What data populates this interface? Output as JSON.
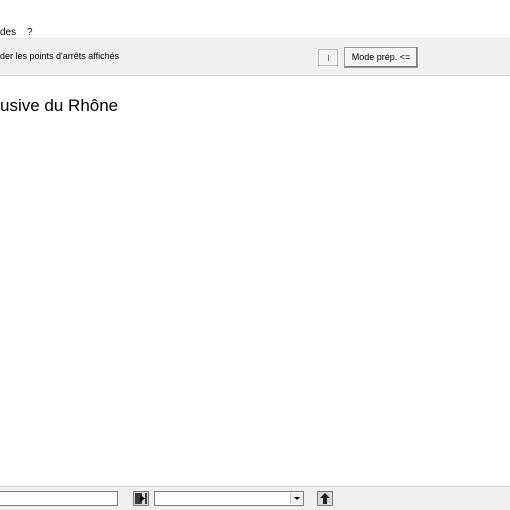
{
  "menubar": {
    "items": [
      "des",
      "?"
    ]
  },
  "toolbar": {
    "label": "der les points d'arrêts affichés",
    "mode_button": "Mode prép. <="
  },
  "content": {
    "title": "usive du Rhône"
  },
  "bottombar": {
    "input_value": "",
    "combo_value": ""
  },
  "icons": {
    "go": "arrow-right-icon",
    "up": "arrow-up-icon"
  }
}
